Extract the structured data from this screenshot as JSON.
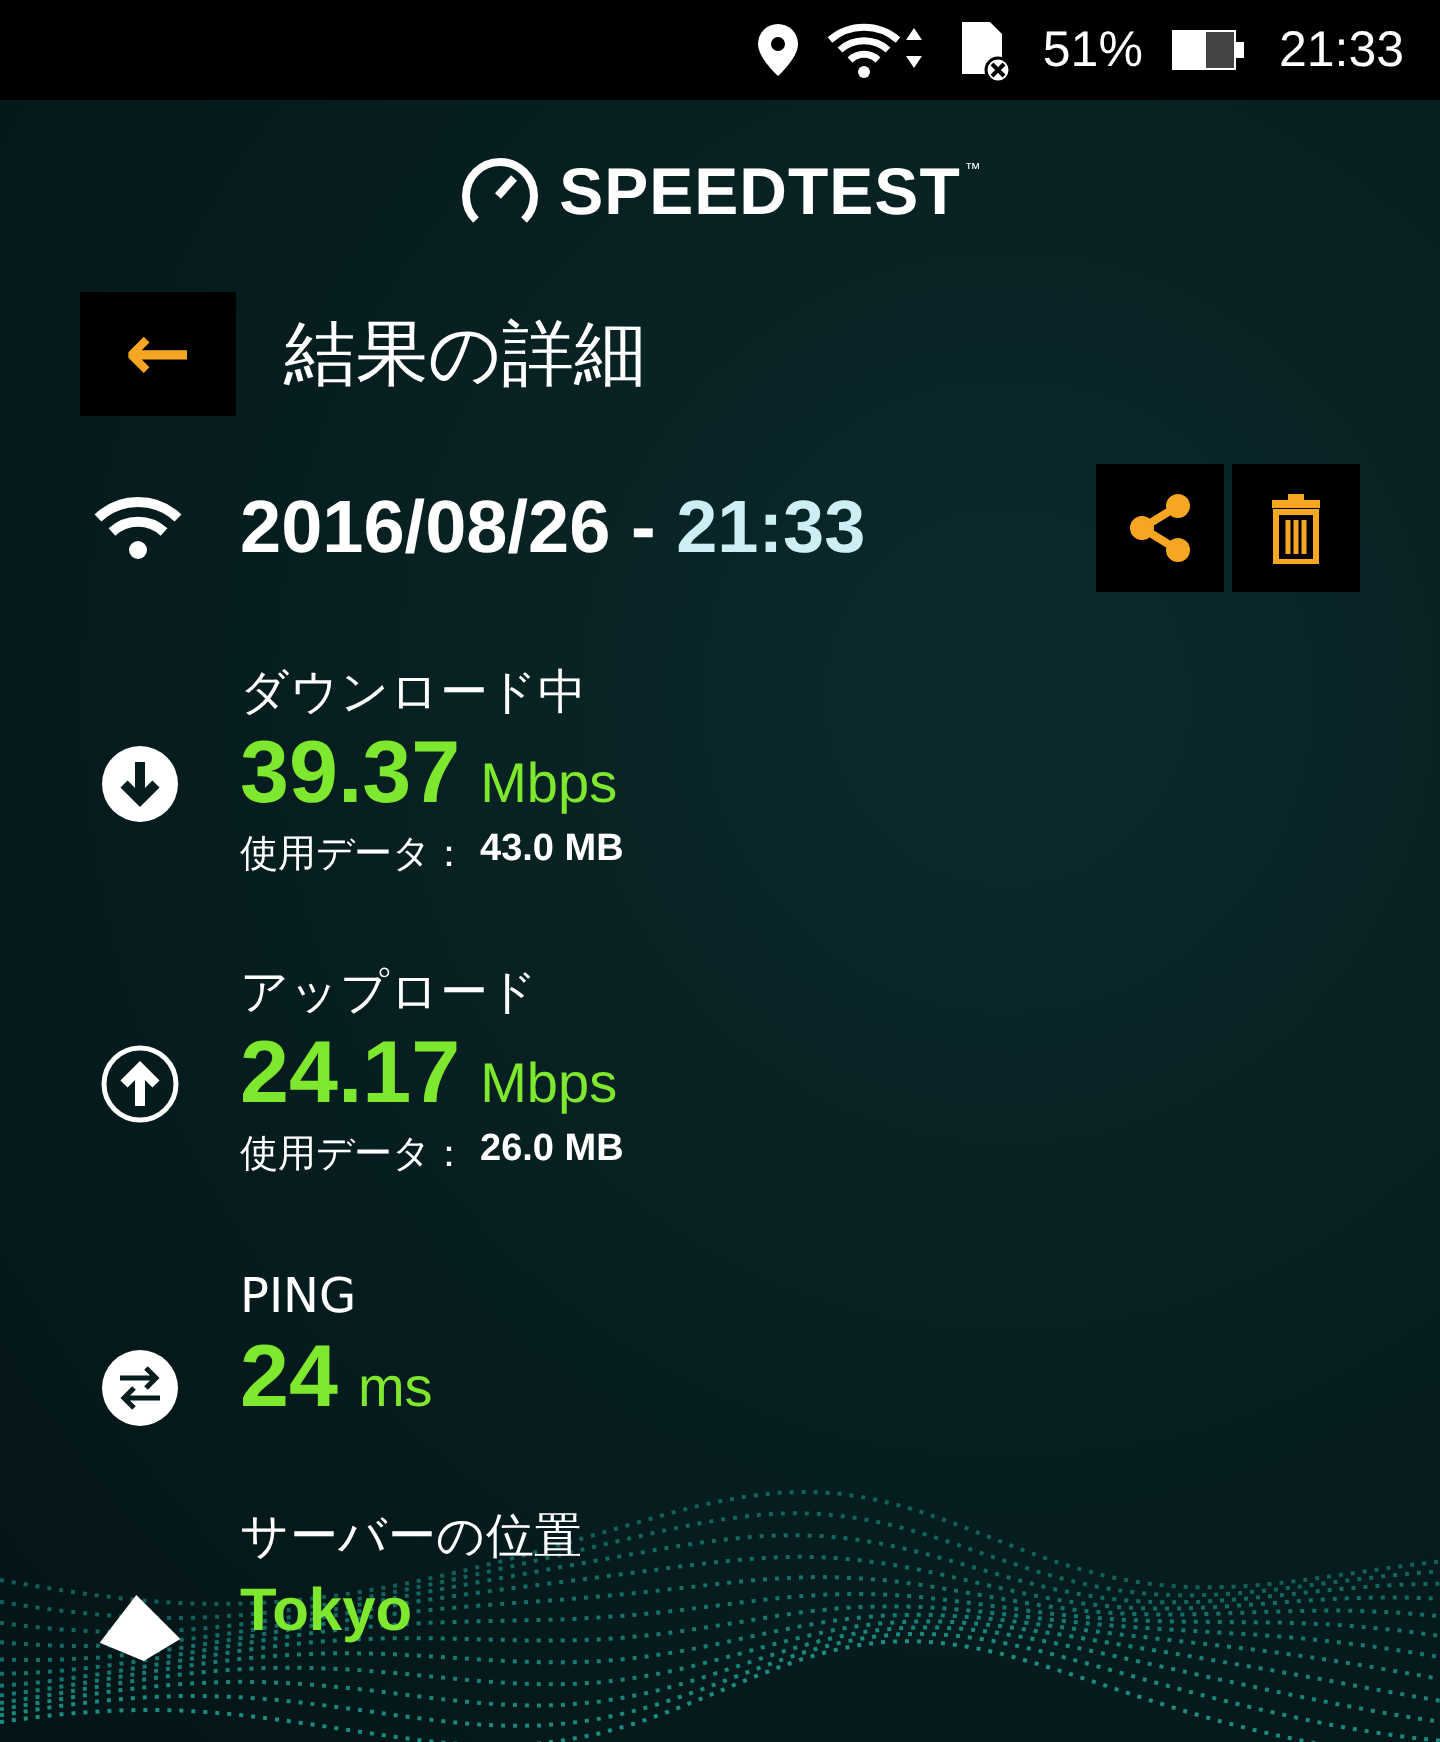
{
  "status_bar": {
    "battery": "51%",
    "time": "21:33"
  },
  "logo": {
    "text": "SPEEDTEST",
    "mark": "™"
  },
  "header": {
    "back": "←",
    "title": "結果の詳細"
  },
  "result": {
    "date": "2016/08/26",
    "separator": "-",
    "time": "21:33"
  },
  "metrics": [
    {
      "kind": "download",
      "label": "ダウンロード中",
      "value": "39.37",
      "unit": "Mbps",
      "data_label": "使用データ：",
      "data_value": "43.0 MB"
    },
    {
      "kind": "upload",
      "label": "アップロード",
      "value": "24.17",
      "unit": "Mbps",
      "data_label": "使用データ：",
      "data_value": "26.0 MB"
    },
    {
      "kind": "ping",
      "label": "PING",
      "value": "24",
      "unit": "ms"
    },
    {
      "kind": "server",
      "label": "サーバーの位置",
      "value": "Tokyo"
    }
  ]
}
